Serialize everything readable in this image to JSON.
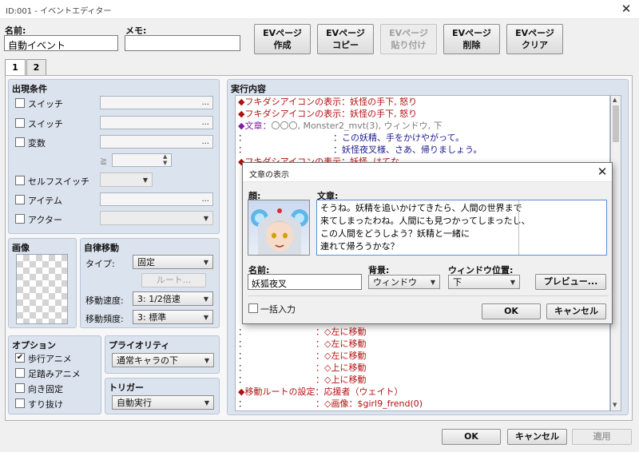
{
  "window": {
    "title": "ID:001 - イベントエディター",
    "close_symbol": "✕"
  },
  "top": {
    "name_label": "名前:",
    "name_value": "自動イベント",
    "memo_label": "メモ:",
    "memo_value": "",
    "buttons": [
      {
        "line1": "EVページ",
        "line2": "作成",
        "disabled": false
      },
      {
        "line1": "EVページ",
        "line2": "コピー",
        "disabled": false
      },
      {
        "line1": "EVページ",
        "line2": "貼り付け",
        "disabled": true
      },
      {
        "line1": "EVページ",
        "line2": "削除",
        "disabled": false
      },
      {
        "line1": "EVページ",
        "line2": "クリア",
        "disabled": false
      }
    ]
  },
  "tabs": [
    "1",
    "2"
  ],
  "conditions": {
    "title": "出現条件",
    "switch1": "スイッチ",
    "switch2": "スイッチ",
    "variable": "変数",
    "ge": "≧",
    "self_switch": "セルフスイッチ",
    "item": "アイテム",
    "actor": "アクター",
    "ellipsis": "..."
  },
  "image": {
    "title": "画像"
  },
  "autonomous": {
    "title": "自律移動",
    "type_label": "タイプ:",
    "type_value": "固定",
    "route_button": "ルート...",
    "speed_label": "移動速度:",
    "speed_value": "3: 1/2倍速",
    "freq_label": "移動頻度:",
    "freq_value": "3: 標準"
  },
  "options": {
    "title": "オプション",
    "items": [
      {
        "label": "歩行アニメ",
        "checked": true
      },
      {
        "label": "足踏みアニメ",
        "checked": false
      },
      {
        "label": "向き固定",
        "checked": false
      },
      {
        "label": "すり抜け",
        "checked": false
      }
    ]
  },
  "priority": {
    "title": "プライオリティ",
    "value": "通常キャラの下"
  },
  "trigger": {
    "title": "トリガー",
    "value": "自動実行"
  },
  "contents": {
    "title": "実行内容",
    "rows_top": [
      {
        "text": "◆フキダシアイコンの表示：妖怪の手下, 怒り",
        "color": "#b01010"
      },
      {
        "text": "◆フキダシアイコンの表示：妖怪の手下, 怒り",
        "color": "#b01010"
      },
      {
        "prefix": "◆文章：",
        "text": "〇〇〇, Monster2_mvt(3), ウィンドウ, 下",
        "color": "#7a7a7a",
        "prefix_color": "#7b1fa2"
      },
      {
        "prefix": "：",
        "text": "　　：この妖精、手をかけやがって。",
        "color": "#1a1a8c",
        "prefix_color": "#333"
      },
      {
        "prefix": "：",
        "text": "　　：妖怪夜叉様、さあ、帰りましょう。",
        "color": "#1a1a8c",
        "prefix_color": "#333"
      },
      {
        "text": "◆フキダシアイコンの表示：妖怪, はてな",
        "color": "#b01010"
      }
    ],
    "rows_bottom": [
      {
        "prefix": "：",
        "text": "：◇左に移動",
        "color": "#b01010"
      },
      {
        "prefix": "：",
        "text": "：◇左に移動",
        "color": "#b01010"
      },
      {
        "prefix": "：",
        "text": "：◇左に移動",
        "color": "#b01010"
      },
      {
        "prefix": "：",
        "text": "：◇上に移動",
        "color": "#b01010"
      },
      {
        "prefix": "：",
        "text": "：◇上に移動",
        "color": "#b01010"
      },
      {
        "text": "◆移動ルートの設定：応援者（ウェイト）",
        "color": "#b01010"
      },
      {
        "prefix": "：",
        "text": "：◇画像：$girl9_frend(0)",
        "color": "#b01010"
      }
    ]
  },
  "dialog": {
    "title": "文章の表示",
    "face_label": "顔:",
    "text_label": "文章:",
    "text_lines": [
      "そうね。妖精を追いかけてきたら、人間の世界まで",
      "来てしまったわね。人間にも見つかってしまったし、",
      "この人間をどうしよう？妖精と一緒に",
      "連れて帰ろうかな？"
    ],
    "name_label": "名前:",
    "name_value": "妖狐夜叉",
    "bg_label": "背景:",
    "bg_value": "ウィンドウ",
    "pos_label": "ウィンドウ位置:",
    "pos_value": "下",
    "preview": "プレビュー...",
    "batch_label": "一括入力",
    "ok": "OK",
    "cancel": "キャンセル"
  },
  "footer": {
    "ok": "OK",
    "cancel": "キャンセル",
    "apply": "適用"
  }
}
